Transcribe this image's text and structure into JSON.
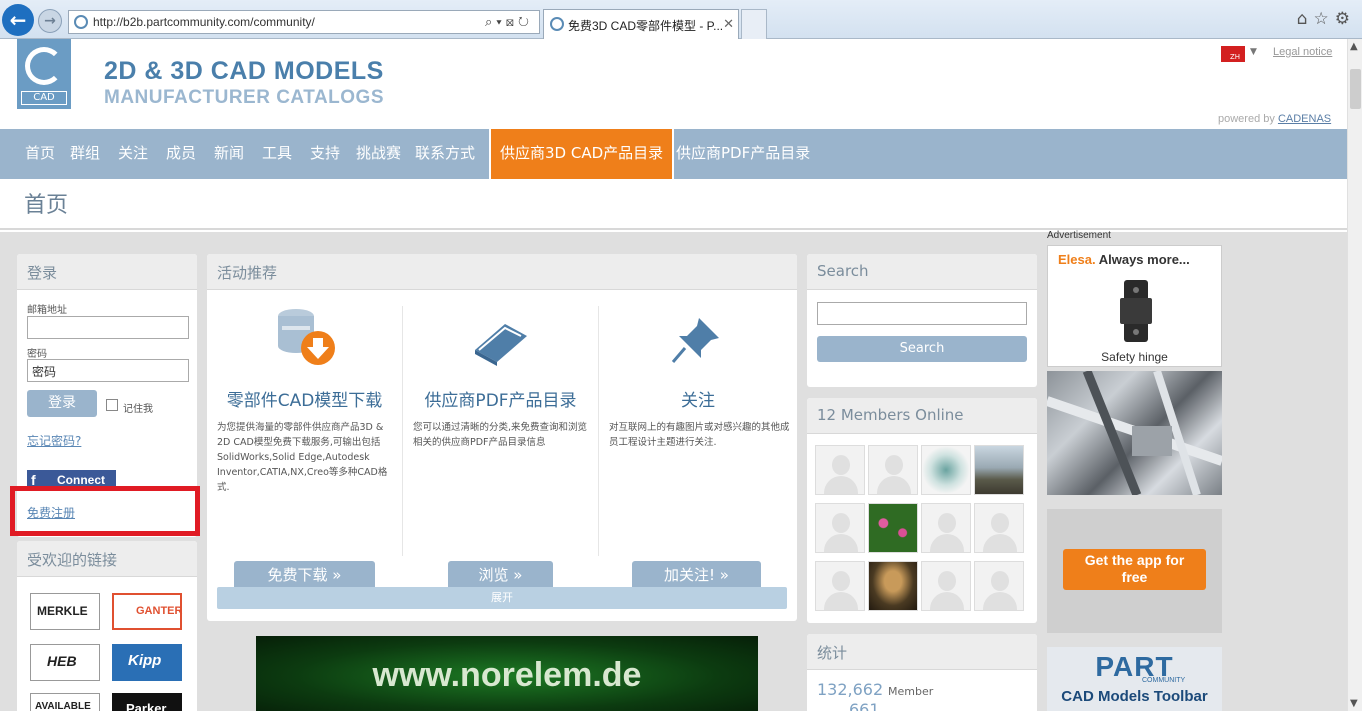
{
  "browser": {
    "url": "http://b2b.partcommunity.com/community/",
    "tab_title": "免费3D CAD零部件模型 - P...",
    "tab_close": "✕",
    "addr_tools": "⌕▾⊠↻",
    "right_icons": "⌂☆⚙"
  },
  "header": {
    "logo_text": "CAD",
    "title": "2D & 3D CAD MODELS",
    "subtitle": "MANUFACTURER CATALOGS",
    "lang": "ZH",
    "legal": "Legal notice",
    "powered_prefix": "powered by",
    "powered_brand": "CADENAS"
  },
  "nav": {
    "items": [
      "首页",
      "群组",
      "关注",
      "成员",
      "新闻",
      "工具",
      "支持",
      "挑战赛",
      "联系方式"
    ],
    "active": "供应商3D CAD产品目录",
    "pdf": "供应商PDF产品目录"
  },
  "page_title": "首页",
  "login": {
    "heading": "登录",
    "email_label": "邮箱地址",
    "email_value": "",
    "password_label": "密码",
    "password_value": "密码",
    "login_button": "登录",
    "remember": "记住我",
    "forgot": "忘记密码?",
    "fb_connect": "Connect",
    "register": "免费注册"
  },
  "popular_links": {
    "heading": "受欢迎的链接",
    "brands": [
      "MERKLE",
      "GANTER",
      "HEB",
      "Kipp",
      "AVAILABLE",
      "Parker"
    ]
  },
  "activity": {
    "heading": "活动推荐",
    "cols": [
      {
        "title": "零部件CAD模型下载",
        "desc": "为您提供海量的零部件供应商产品3D & 2D CAD模型免费下载服务,可输出包括SolidWorks,Solid Edge,Autodesk Inventor,CATIA,NX,Creo等多种CAD格式.",
        "button": "免费下载 »"
      },
      {
        "title": "供应商PDF产品目录",
        "desc": "您可以通过清晰的分类,来免费查询和浏览相关的供应商PDF产品目录信息",
        "button": "浏览 »"
      },
      {
        "title": "关注",
        "desc": "对互联网上的有趣图片或对感兴趣的其他成员工程设计主题进行关注.",
        "button": "加关注! »"
      }
    ],
    "expand": "展开"
  },
  "banner": {
    "text": "www.norelem.de"
  },
  "search": {
    "heading": "Search",
    "placeholder": "",
    "button": "Search"
  },
  "members": {
    "heading": "12 Members Online"
  },
  "stats": {
    "heading": "统计",
    "members_count": "132,662",
    "members_label": "Member",
    "second_value": "661"
  },
  "ads": {
    "label": "Advertisement",
    "elesa_brand": "Elesa.",
    "elesa_tagline": "Always more...",
    "elesa_caption": "Safety hinge",
    "app_button": "Get the app for free",
    "part_logo": "PART",
    "part_community": "COMMUNITY",
    "part_toolbar": "CAD Models Toolbar"
  }
}
